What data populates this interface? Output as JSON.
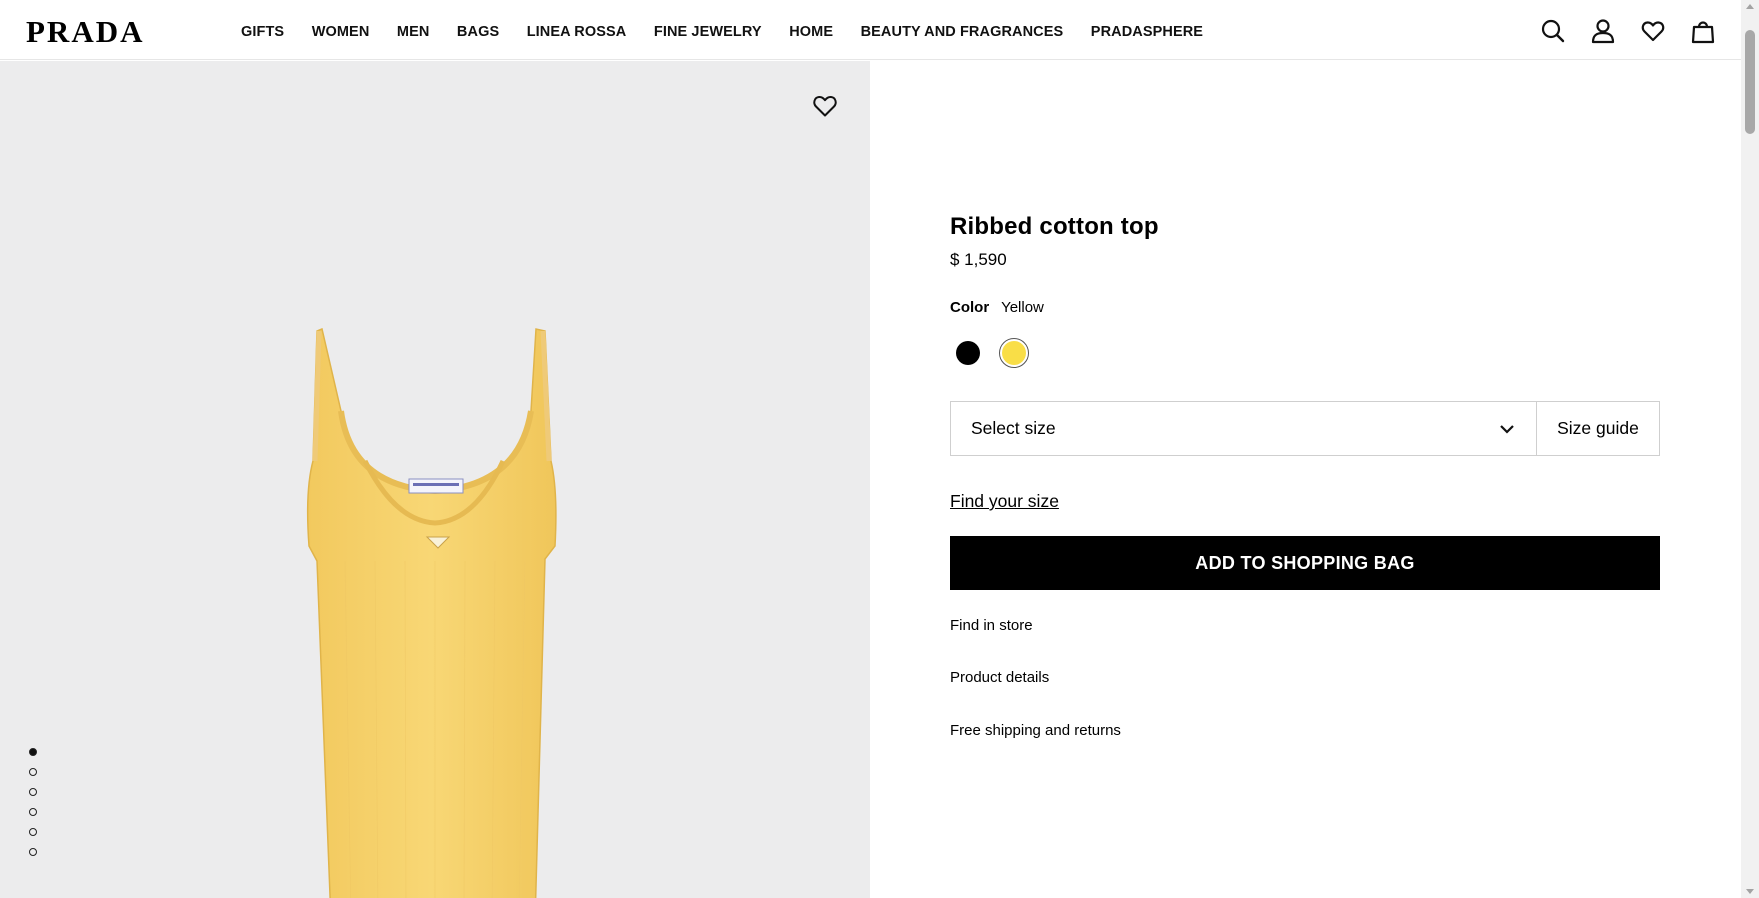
{
  "header": {
    "logo": "PRADA",
    "nav": [
      "GIFTS",
      "WOMEN",
      "MEN",
      "BAGS",
      "LINEA ROSSA",
      "FINE JEWELRY",
      "HOME",
      "BEAUTY AND FRAGRANCES",
      "PRADASPHERE"
    ],
    "icons": [
      "search-icon",
      "account-icon",
      "wishlist-icon",
      "shopping-bag-icon"
    ]
  },
  "gallery": {
    "image_count": 6,
    "active_index": 1
  },
  "product": {
    "title": "Ribbed cotton top",
    "price": "$ 1,590",
    "color_label": "Color",
    "color_value": "Yellow",
    "swatches": [
      {
        "name": "Black",
        "hex": "#000000"
      },
      {
        "name": "Yellow",
        "hex": "#f9de47",
        "selected": true
      }
    ],
    "size_placeholder": "Select size",
    "size_guide": "Size guide",
    "find_size": "Find your size",
    "add_to_bag": "ADD TO SHOPPING BAG",
    "links": [
      "Find in store",
      "Product details",
      "Free shipping and returns"
    ]
  }
}
